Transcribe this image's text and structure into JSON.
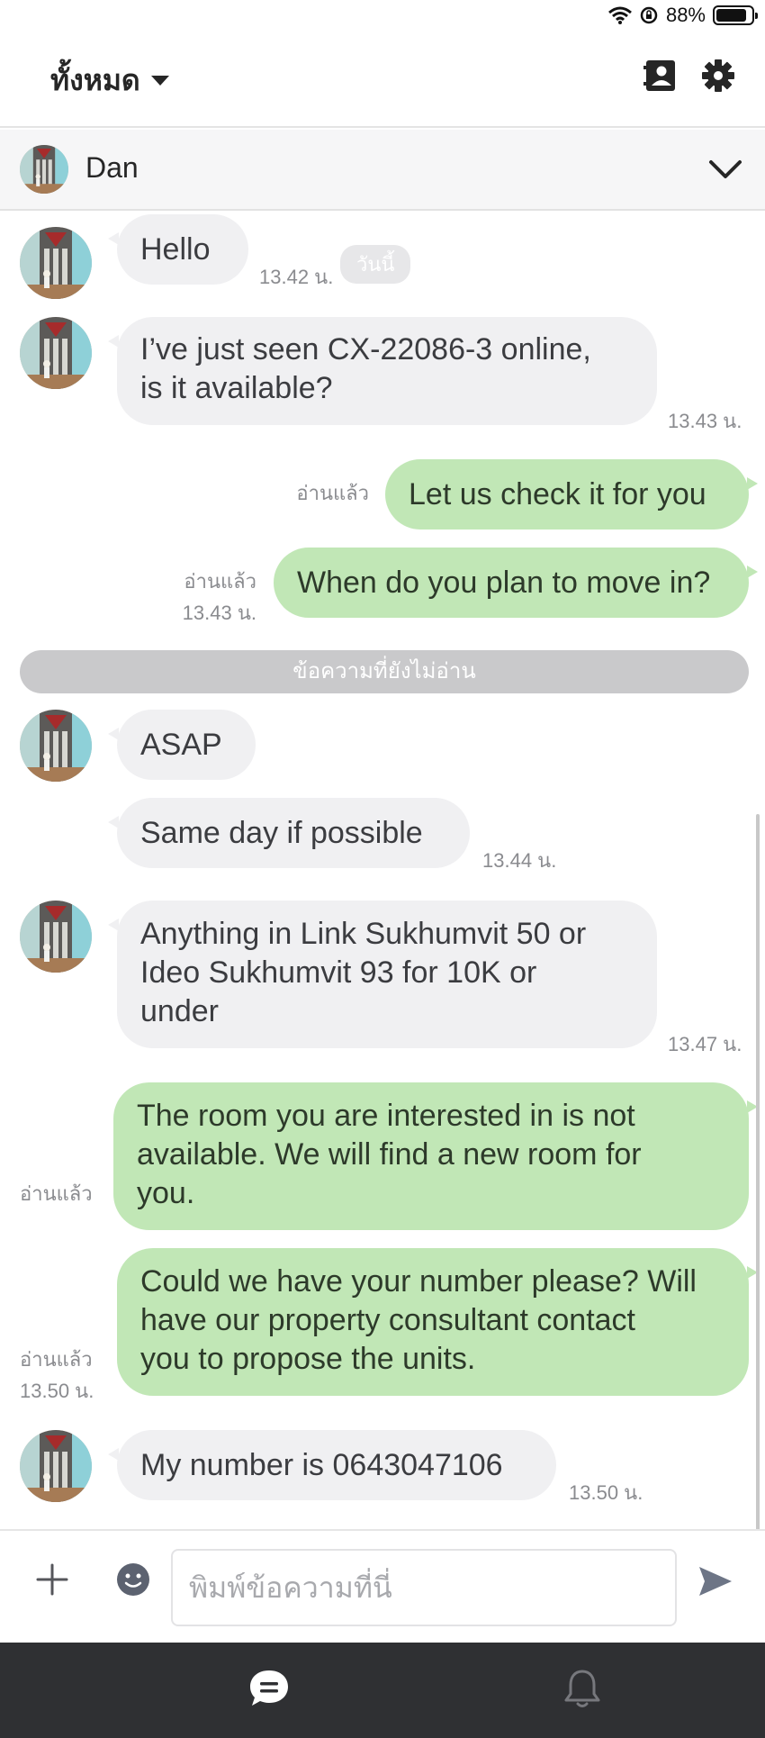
{
  "status": {
    "battery_percent": "88%",
    "battery_level": 0.88
  },
  "header": {
    "filter_label": "ทั้งหมด"
  },
  "chat": {
    "name": "Dan"
  },
  "messages": {
    "m1": {
      "text": "Hello",
      "time": "13.42 น."
    },
    "today_label": "วันนี้",
    "m2": {
      "line1": "I’ve just seen CX-22086-3 online,",
      "line2": "is it available?",
      "time": "13.43 น."
    },
    "m3": {
      "text": "Let us check it for you",
      "read": "อ่านแล้ว"
    },
    "m4": {
      "text": "When do you plan to move in?",
      "read": "อ่านแล้ว",
      "time": "13.43 น."
    },
    "unread_divider": "ข้อความที่ยังไม่อ่าน",
    "m5": {
      "text": "ASAP"
    },
    "m6": {
      "text": "Same day if possible",
      "time": "13.44 น."
    },
    "m7": {
      "line1": "Anything in Link Sukhumvit 50 or",
      "line2": "Ideo Sukhumvit 93 for 10K or",
      "line3": "under",
      "time": "13.47 น."
    },
    "m8": {
      "line1": "The room you are interested in is not",
      "line2": "available.  We will find a new room for",
      "line3": "you.",
      "read": "อ่านแล้ว"
    },
    "m9": {
      "line1": "Could we have your number please? Will",
      "line2": "have our property consultant contact",
      "line3": "you to propose the units.",
      "read": "อ่านแล้ว",
      "time": "13.50 น."
    },
    "m10": {
      "text": "My number is 0643047106",
      "time": "13.50 น."
    }
  },
  "composer": {
    "placeholder": "พิมพ์ข้อความที่นี่"
  },
  "icons": {
    "filter": "chevron-down-icon",
    "contacts": "contact-card-icon",
    "settings": "gear-icon",
    "collapse": "chevron-down-icon",
    "add": "plus-icon",
    "emoji": "smiley-icon",
    "send": "send-icon",
    "chats_tab": "chat-bubble-icon",
    "notifications_tab": "bell-icon"
  },
  "colors": {
    "outgoing_bubble": "#c1e7b6",
    "incoming_bubble": "#f0f0f2",
    "tabbar": "#2f3033"
  }
}
